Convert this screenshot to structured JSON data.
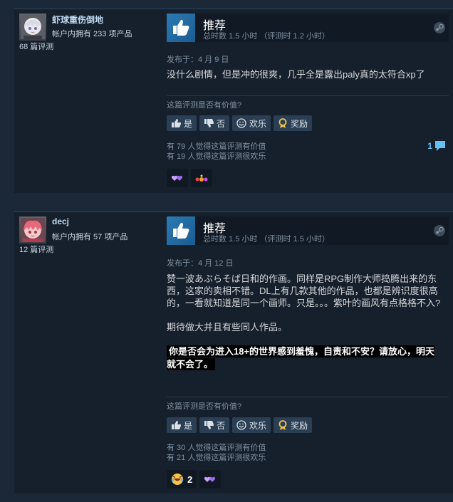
{
  "colors": {
    "background": "#1b2838",
    "card": "#16202d",
    "accent": "#66c0f4",
    "thumb": "#2c7ab4"
  },
  "buttons": {
    "yes": "是",
    "no": "否",
    "funny": "欢乐",
    "award": "奖励"
  },
  "helpful_question": "这篇评测是否有价值?",
  "reviews": [
    {
      "author": {
        "name": "虾球重伤倒地",
        "products_owned": "帐户内拥有 233 项产品",
        "reviews_count": "68 篇评测",
        "avatar": "anime-girl-white-hair"
      },
      "recommendation": "推荐",
      "hours": "总时数 1.5 小时 （评测时 1.2 小时）",
      "posted": "发布于：4 月 9 日",
      "text": [
        "没什么剧情，但是冲的很爽，几乎全是露出paly真的太符合xp了"
      ],
      "spoiler": "",
      "helpful_votes": "有 79 人觉得这篇评测有价值",
      "funny_votes": "有 19 人觉得这篇评测很欢乐",
      "comments": "1",
      "reactions": [
        {
          "icon": "hearts-icon",
          "count": ""
        },
        {
          "icon": "dots-icon",
          "count": ""
        }
      ]
    },
    {
      "author": {
        "name": "decj",
        "products_owned": "帐户内拥有 57 项产品",
        "reviews_count": "12 篇评测",
        "avatar": "anime-girl-pink-hair"
      },
      "recommendation": "推荐",
      "hours": "总时数 1.5 小时 （评测时 1.5 小时）",
      "posted": "发布于：4 月 12 日",
      "text": [
        "赞一波あぶらそば日和的作画。同样是RPG制作大师捣腾出来的东西，这家的卖相不错。DL上有几款其他的作品，也都是辨识度很高的，一看就知道是同一个画师。只是。。。紫叶的画风有点格格不入?",
        "期待做大并且有些同人作品。"
      ],
      "spoiler": "你是否会为进入18+的世界感到羞愧，自责和不安？请放心，明天就不会了。",
      "helpful_votes": "有 30 人觉得这篇评测有价值",
      "funny_votes": "有 21 人觉得这篇评测很欢乐",
      "comments": "",
      "reactions": [
        {
          "icon": "laughing-face-icon",
          "count": "2"
        },
        {
          "icon": "hearts-icon",
          "count": ""
        }
      ]
    }
  ]
}
